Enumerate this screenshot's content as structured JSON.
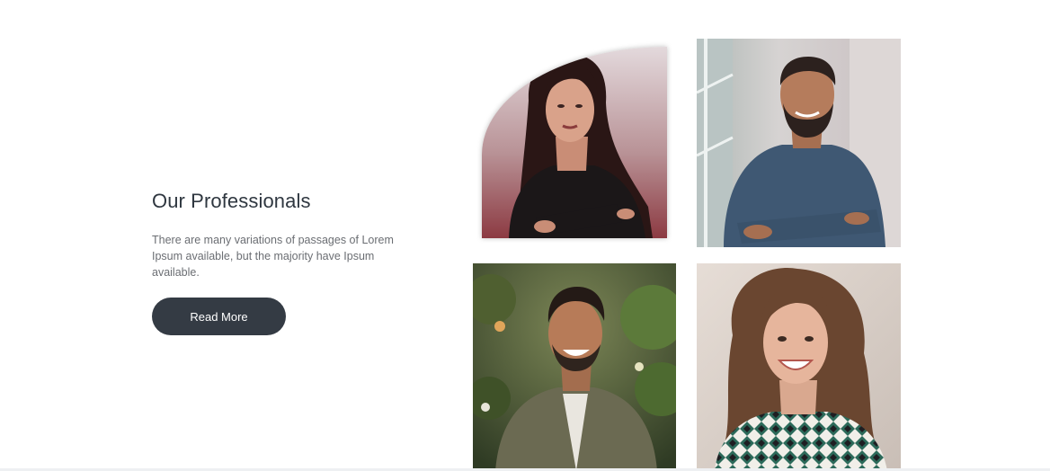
{
  "section": {
    "title": "Our Professionals",
    "description": "There are many variations of passages of Lorem Ipsum available, but the majority have Ipsum available.",
    "button_label": "Read More"
  },
  "colors": {
    "heading": "#2f3740",
    "body_text": "#6b6e73",
    "button_bg": "#343b44",
    "button_text": "#ffffff"
  }
}
